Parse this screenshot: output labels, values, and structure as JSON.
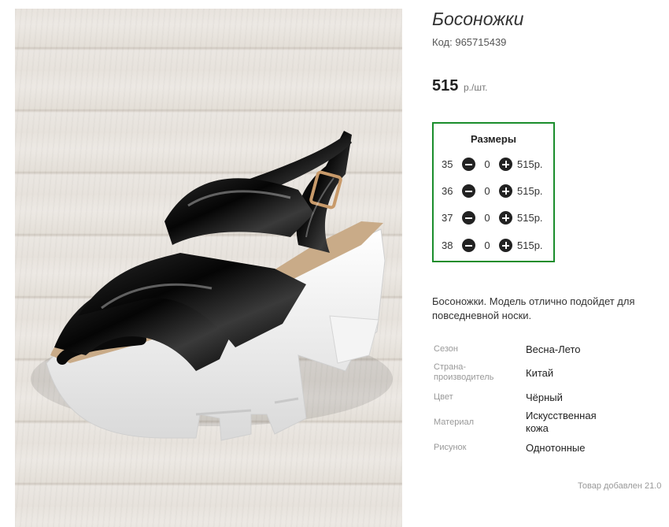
{
  "product": {
    "title": "Босоножки",
    "code_label": "Код:",
    "code_value": "965715439",
    "price_value": "515",
    "price_unit": "р./шт.",
    "image_alt": "Босоножки"
  },
  "sizes": {
    "title": "Размеры",
    "rows": [
      {
        "size": "35",
        "qty": "0",
        "price": "515р."
      },
      {
        "size": "36",
        "qty": "0",
        "price": "515р."
      },
      {
        "size": "37",
        "qty": "0",
        "price": "515р."
      },
      {
        "size": "38",
        "qty": "0",
        "price": "515р."
      }
    ]
  },
  "description": "Босоножки. Модель отлично подойдет для повседневной носки.",
  "properties": [
    {
      "key": "Сезон",
      "value": "Весна-Лето"
    },
    {
      "key": "Страна-производитель",
      "value": "Китай"
    },
    {
      "key": "Цвет",
      "value": "Чёрный"
    },
    {
      "key": "Материал",
      "value": "Искусственная кожа"
    },
    {
      "key": "Рисунок",
      "value": "Однотонные"
    }
  ],
  "added_text": "Товар добавлен 21.0",
  "colors": {
    "accent_border": "#1a8d2c",
    "button": "#222222",
    "wood": "#e8e3dd"
  },
  "icons": {
    "minus": "minus-circle-icon",
    "plus": "plus-circle-icon"
  }
}
